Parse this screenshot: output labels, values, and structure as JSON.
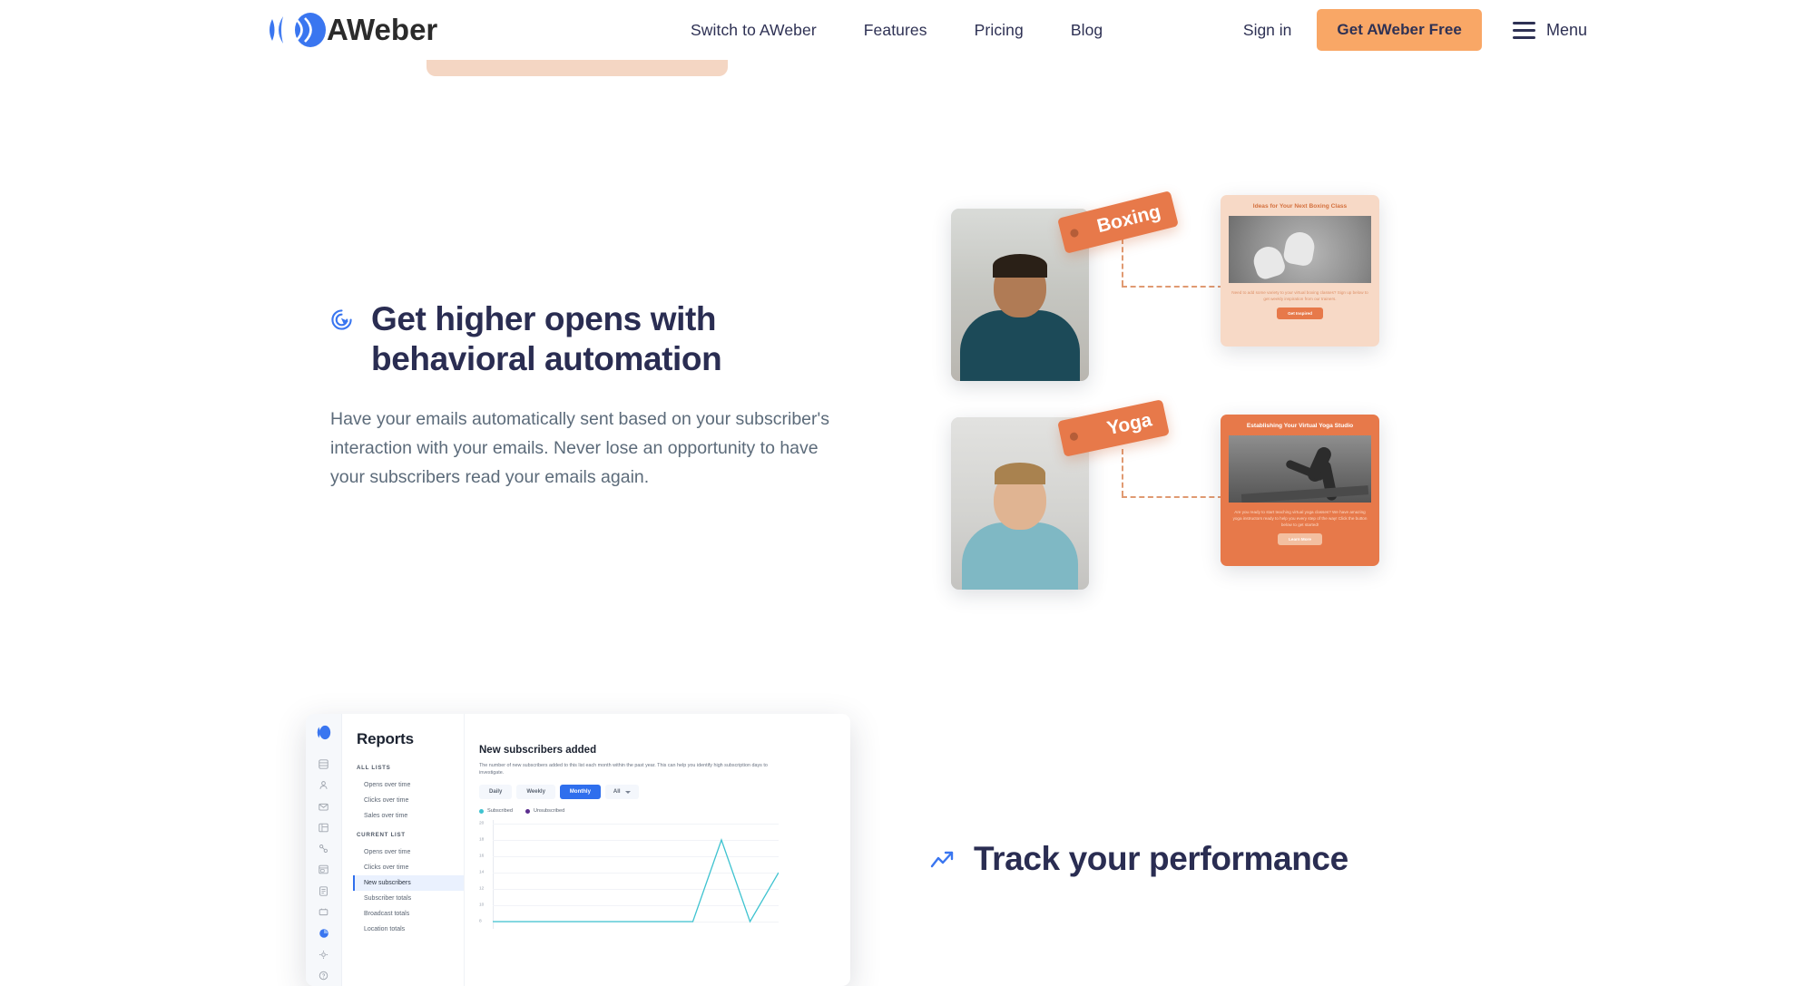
{
  "nav": {
    "logo_text": "AWeber",
    "links": [
      {
        "label": "Switch to AWeber"
      },
      {
        "label": "Features"
      },
      {
        "label": "Pricing"
      },
      {
        "label": "Blog"
      }
    ],
    "signin_label": "Sign in",
    "cta_label": "Get AWeber Free",
    "menu_label": "Menu",
    "link_color": "#2E3154",
    "cta_bg": "#F9A766"
  },
  "section_automation": {
    "icon": "click-target-icon",
    "title": "Get higher opens with behavioral automation",
    "body": "Have your emails automatically sent based on your subscriber's interaction with your emails. Never lose an opportunity to have your subscribers read your emails again.",
    "title_color": "#2A2D52",
    "body_color": "#5C6B7A"
  },
  "illustration": {
    "accent": "#E7794A",
    "items": [
      {
        "tag": "Boxing",
        "photo_alt": "Smiling man in gym wearing teal shirt",
        "email": {
          "title": "Ideas for Your Next Boxing Class",
          "body": "Need to add some variety to your virtual boxing classes? Sign up below to get weekly inspiration from our trainers.",
          "button": "Get Inspired",
          "image_alt": "Pair of white boxing gloves"
        }
      },
      {
        "tag": "Yoga",
        "photo_alt": "Smiling woman in teal tank top",
        "email": {
          "title": "Establishing Your Virtual Yoga Studio",
          "body": "Are you ready to start teaching virtual yoga classes? We have amazing yoga instructors ready to help you every step of the way! Click the button below to get started!",
          "button": "Learn More",
          "image_alt": "Person in downward dog yoga pose"
        }
      }
    ]
  },
  "section_performance": {
    "icon": "trending-up-icon",
    "title": "Track your performance",
    "title_color": "#2A2D52"
  },
  "reports_app": {
    "brand": "Reports",
    "groups": [
      {
        "label": "ALL LISTS",
        "items": [
          "Opens over time",
          "Clicks over time",
          "Sales over time"
        ]
      },
      {
        "label": "CURRENT LIST",
        "items": [
          "Opens over time",
          "Clicks over time",
          "New subscribers",
          "Subscriber totals",
          "Broadcast totals",
          "Location totals"
        ]
      }
    ],
    "selected_item": "New subscribers",
    "panel": {
      "title": "New subscribers added",
      "description": "The number of new subscribers added to this list each month within the past year. This can help you identify high subscription days to investigate.",
      "tabs": [
        "Daily",
        "Weekly",
        "Monthly"
      ],
      "active_tab": "Monthly",
      "filter_label": "All"
    },
    "chart_data": {
      "type": "line",
      "title": "New subscribers added",
      "xlabel": "",
      "ylabel": "",
      "ylim": [
        8,
        20
      ],
      "yticks": [
        20,
        18,
        16,
        14,
        12,
        10,
        8
      ],
      "grid": true,
      "legend_position": "top-left",
      "series": [
        {
          "name": "Subscribed",
          "color": "#3FC3D0",
          "values": [
            8,
            8,
            8,
            8,
            8,
            8,
            8,
            8,
            18,
            8,
            14
          ]
        },
        {
          "name": "Unsubscribed",
          "color": "#5B2D8E",
          "values": [
            0,
            0,
            0,
            0,
            0,
            0,
            0,
            0,
            0,
            0,
            0
          ]
        }
      ]
    }
  }
}
